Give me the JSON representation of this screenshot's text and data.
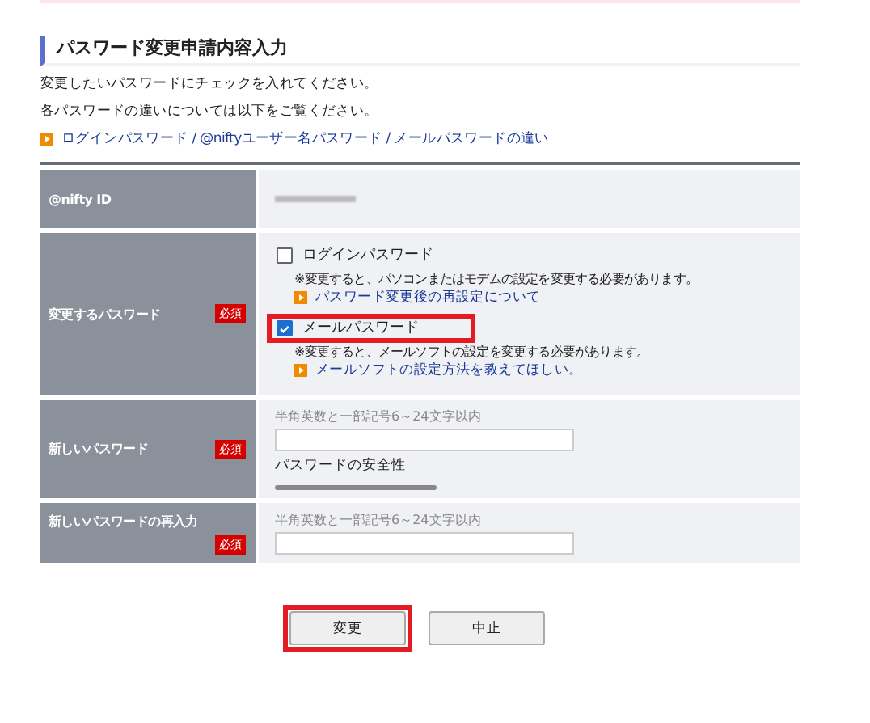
{
  "heading": "パスワード変更申請内容入力",
  "intro": [
    "変更したいパスワードにチェックを入れてください。",
    "各パスワードの違いについては以下をご覧ください。"
  ],
  "top_link": "ログインパスワード / @niftyユーザー名パスワード / メールパスワードの違い",
  "rows": [
    {
      "kind": "id",
      "label": "@nifty ID",
      "required": false
    },
    {
      "kind": "checkboxes",
      "label": "変更するパスワード",
      "required": true,
      "required_badge": "必須",
      "options": [
        {
          "label": "ログインパスワード",
          "checked": false,
          "highlighted": false,
          "note": "※変更すると、パソコンまたはモデムの設定を変更する必要があります。",
          "link": "パスワード変更後の再設定について"
        },
        {
          "label": "メールパスワード",
          "checked": true,
          "highlighted": true,
          "note": "※変更すると、メールソフトの設定を変更する必要があります。",
          "link": "メールソフトの設定方法を教えてほしい。"
        }
      ]
    },
    {
      "kind": "password",
      "label": "新しいパスワード",
      "required": true,
      "required_badge": "必須",
      "hint": "半角英数と一部記号6～24文字以内",
      "strength_label": "パスワードの安全性"
    },
    {
      "kind": "password",
      "label": "新しいパスワードの再入力",
      "required": true,
      "required_badge": "必須",
      "hint": "半角英数と一部記号6～24文字以内"
    }
  ],
  "buttons": [
    {
      "label": "変更",
      "highlighted": true
    },
    {
      "label": "中止",
      "highlighted": false
    }
  ]
}
